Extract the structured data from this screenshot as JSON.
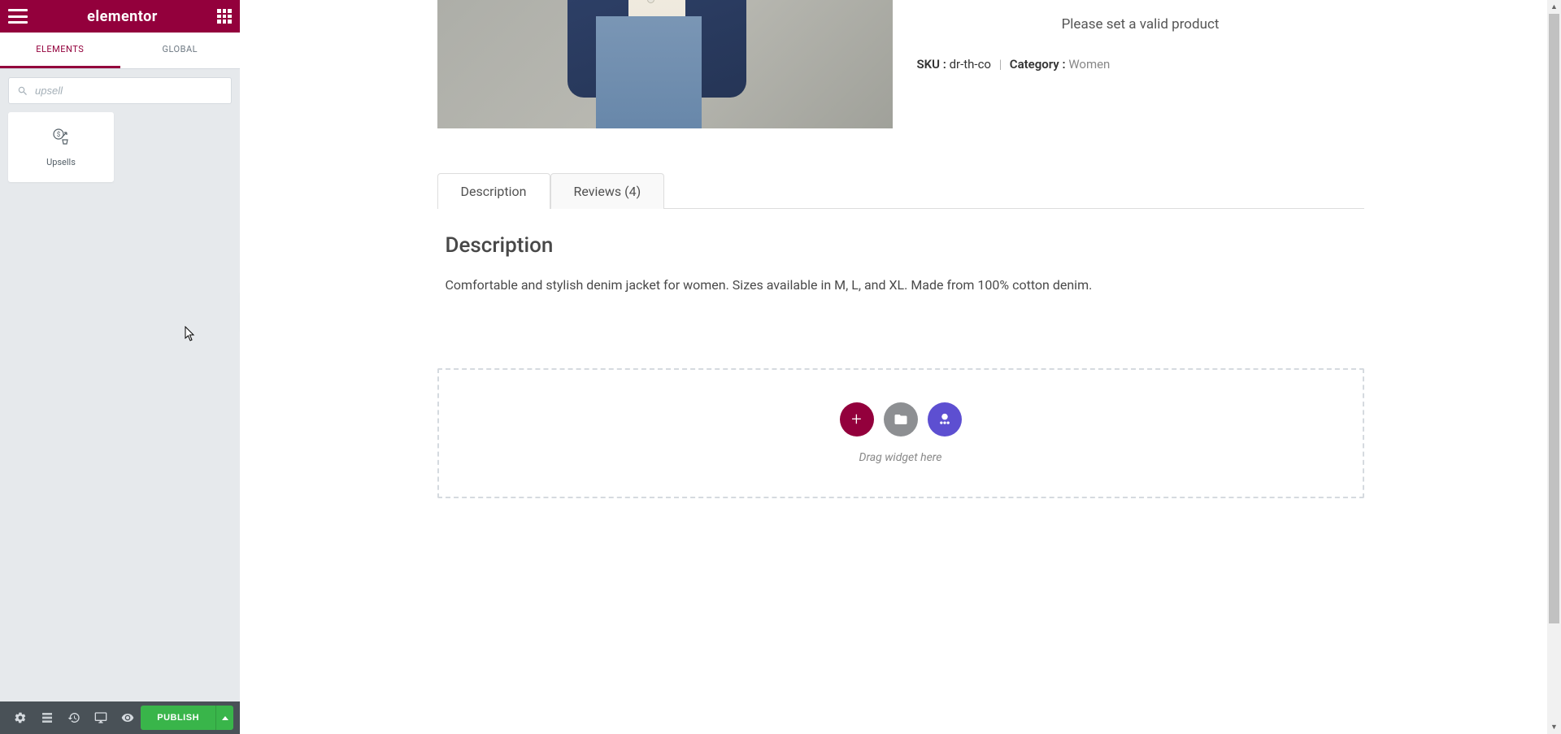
{
  "header": {
    "logo": "elementor"
  },
  "panel": {
    "tabs": {
      "elements": "ELEMENTS",
      "global": "GLOBAL"
    },
    "search_value": "upsell",
    "widgets": [
      {
        "label": "Upsells"
      }
    ]
  },
  "footer": {
    "publish": "PUBLISH"
  },
  "product": {
    "notice": "Please set a valid product",
    "sku_label": "SKU :",
    "sku_value": "dr-th-co",
    "category_label": "Category :",
    "category_value": "Women"
  },
  "tabs": {
    "description": "Description",
    "reviews": "Reviews (4)"
  },
  "content": {
    "heading": "Description",
    "body": "Comfortable and stylish denim jacket for women. Sizes available in M, L, and XL. Made from 100% cotton denim."
  },
  "drop": {
    "label": "Drag widget here"
  }
}
